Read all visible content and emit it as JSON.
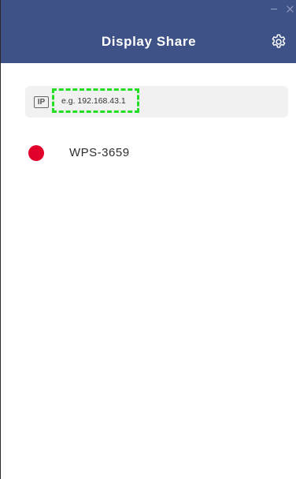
{
  "window": {
    "title": "Display Share",
    "controls": [
      "minimize-icon",
      "close-icon"
    ]
  },
  "header": {
    "settings_icon": "gear-icon"
  },
  "ip_bar": {
    "badge": "IP",
    "placeholder": "e.g. 192.168.43.1",
    "value": ""
  },
  "devices": [
    {
      "name": "WPS-3659",
      "status_color": "#e0002b"
    }
  ],
  "colors": {
    "header_bg": "#3f5287",
    "ip_bar_bg": "#f1f1f1",
    "highlight": "#22dd22"
  }
}
